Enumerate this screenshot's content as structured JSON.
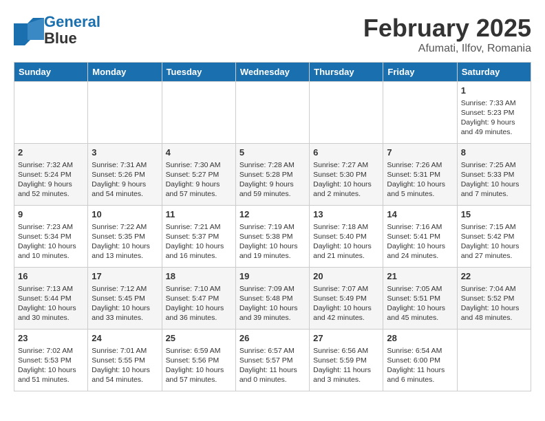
{
  "header": {
    "logo_line1": "General",
    "logo_line2": "Blue",
    "month_title": "February 2025",
    "subtitle": "Afumati, Ilfov, Romania"
  },
  "weekdays": [
    "Sunday",
    "Monday",
    "Tuesday",
    "Wednesday",
    "Thursday",
    "Friday",
    "Saturday"
  ],
  "weeks": [
    [
      {
        "day": "",
        "info": ""
      },
      {
        "day": "",
        "info": ""
      },
      {
        "day": "",
        "info": ""
      },
      {
        "day": "",
        "info": ""
      },
      {
        "day": "",
        "info": ""
      },
      {
        "day": "",
        "info": ""
      },
      {
        "day": "1",
        "info": "Sunrise: 7:33 AM\nSunset: 5:23 PM\nDaylight: 9 hours and 49 minutes."
      }
    ],
    [
      {
        "day": "2",
        "info": "Sunrise: 7:32 AM\nSunset: 5:24 PM\nDaylight: 9 hours and 52 minutes."
      },
      {
        "day": "3",
        "info": "Sunrise: 7:31 AM\nSunset: 5:26 PM\nDaylight: 9 hours and 54 minutes."
      },
      {
        "day": "4",
        "info": "Sunrise: 7:30 AM\nSunset: 5:27 PM\nDaylight: 9 hours and 57 minutes."
      },
      {
        "day": "5",
        "info": "Sunrise: 7:28 AM\nSunset: 5:28 PM\nDaylight: 9 hours and 59 minutes."
      },
      {
        "day": "6",
        "info": "Sunrise: 7:27 AM\nSunset: 5:30 PM\nDaylight: 10 hours and 2 minutes."
      },
      {
        "day": "7",
        "info": "Sunrise: 7:26 AM\nSunset: 5:31 PM\nDaylight: 10 hours and 5 minutes."
      },
      {
        "day": "8",
        "info": "Sunrise: 7:25 AM\nSunset: 5:33 PM\nDaylight: 10 hours and 7 minutes."
      }
    ],
    [
      {
        "day": "9",
        "info": "Sunrise: 7:23 AM\nSunset: 5:34 PM\nDaylight: 10 hours and 10 minutes."
      },
      {
        "day": "10",
        "info": "Sunrise: 7:22 AM\nSunset: 5:35 PM\nDaylight: 10 hours and 13 minutes."
      },
      {
        "day": "11",
        "info": "Sunrise: 7:21 AM\nSunset: 5:37 PM\nDaylight: 10 hours and 16 minutes."
      },
      {
        "day": "12",
        "info": "Sunrise: 7:19 AM\nSunset: 5:38 PM\nDaylight: 10 hours and 19 minutes."
      },
      {
        "day": "13",
        "info": "Sunrise: 7:18 AM\nSunset: 5:40 PM\nDaylight: 10 hours and 21 minutes."
      },
      {
        "day": "14",
        "info": "Sunrise: 7:16 AM\nSunset: 5:41 PM\nDaylight: 10 hours and 24 minutes."
      },
      {
        "day": "15",
        "info": "Sunrise: 7:15 AM\nSunset: 5:42 PM\nDaylight: 10 hours and 27 minutes."
      }
    ],
    [
      {
        "day": "16",
        "info": "Sunrise: 7:13 AM\nSunset: 5:44 PM\nDaylight: 10 hours and 30 minutes."
      },
      {
        "day": "17",
        "info": "Sunrise: 7:12 AM\nSunset: 5:45 PM\nDaylight: 10 hours and 33 minutes."
      },
      {
        "day": "18",
        "info": "Sunrise: 7:10 AM\nSunset: 5:47 PM\nDaylight: 10 hours and 36 minutes."
      },
      {
        "day": "19",
        "info": "Sunrise: 7:09 AM\nSunset: 5:48 PM\nDaylight: 10 hours and 39 minutes."
      },
      {
        "day": "20",
        "info": "Sunrise: 7:07 AM\nSunset: 5:49 PM\nDaylight: 10 hours and 42 minutes."
      },
      {
        "day": "21",
        "info": "Sunrise: 7:05 AM\nSunset: 5:51 PM\nDaylight: 10 hours and 45 minutes."
      },
      {
        "day": "22",
        "info": "Sunrise: 7:04 AM\nSunset: 5:52 PM\nDaylight: 10 hours and 48 minutes."
      }
    ],
    [
      {
        "day": "23",
        "info": "Sunrise: 7:02 AM\nSunset: 5:53 PM\nDaylight: 10 hours and 51 minutes."
      },
      {
        "day": "24",
        "info": "Sunrise: 7:01 AM\nSunset: 5:55 PM\nDaylight: 10 hours and 54 minutes."
      },
      {
        "day": "25",
        "info": "Sunrise: 6:59 AM\nSunset: 5:56 PM\nDaylight: 10 hours and 57 minutes."
      },
      {
        "day": "26",
        "info": "Sunrise: 6:57 AM\nSunset: 5:57 PM\nDaylight: 11 hours and 0 minutes."
      },
      {
        "day": "27",
        "info": "Sunrise: 6:56 AM\nSunset: 5:59 PM\nDaylight: 11 hours and 3 minutes."
      },
      {
        "day": "28",
        "info": "Sunrise: 6:54 AM\nSunset: 6:00 PM\nDaylight: 11 hours and 6 minutes."
      },
      {
        "day": "",
        "info": ""
      }
    ]
  ]
}
